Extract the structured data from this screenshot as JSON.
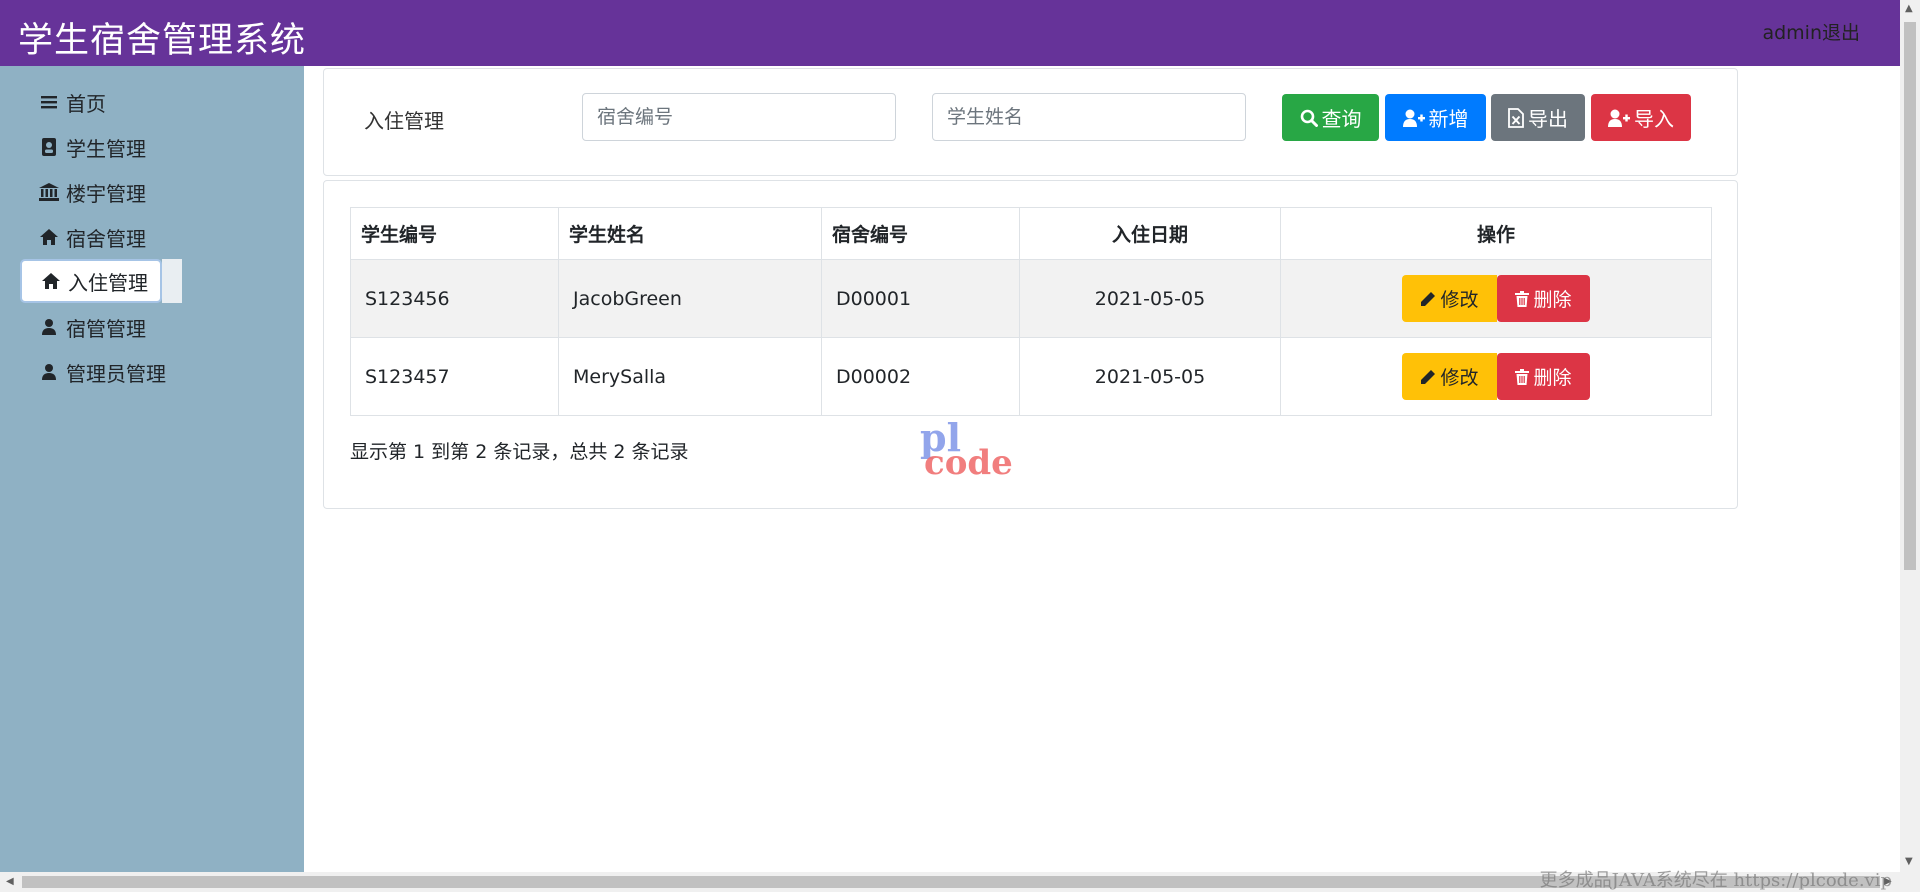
{
  "header": {
    "app_title": "学生宿舍管理系统",
    "logout_label": "admin退出",
    "background": "#663399"
  },
  "sidebar": {
    "background": "#8fb1c4",
    "items": [
      {
        "label": "首页",
        "icon": "bars-icon"
      },
      {
        "label": "学生管理",
        "icon": "id-card-icon"
      },
      {
        "label": "楼宇管理",
        "icon": "building-icon"
      },
      {
        "label": "宿舍管理",
        "icon": "home-icon"
      },
      {
        "label": "入住管理",
        "icon": "home-icon",
        "active": true
      },
      {
        "label": "宿管管理",
        "icon": "user-icon"
      },
      {
        "label": "管理员管理",
        "icon": "user-icon"
      }
    ]
  },
  "search": {
    "page_label": "入住管理",
    "dorm_placeholder": "宿舍编号",
    "name_placeholder": "学生姓名",
    "query_label": "查询",
    "add_label": "新增",
    "export_label": "导出",
    "import_label": "导入"
  },
  "table": {
    "columns": [
      "学生编号",
      "学生姓名",
      "宿舍编号",
      "入住日期",
      "操作"
    ],
    "rows": [
      {
        "student_id": "S123456",
        "student_name": "JacobGreen",
        "dorm_id": "D00001",
        "date": "2021-05-05"
      },
      {
        "student_id": "S123457",
        "student_name": "MerySalla",
        "dorm_id": "D00002",
        "date": "2021-05-05"
      }
    ],
    "edit_label": "修改",
    "delete_label": "删除"
  },
  "pagination": {
    "summary": "显示第 1 到第 2 条记录，总共 2 条记录"
  },
  "watermark": {
    "logo_top": "pl",
    "logo_bottom": "code",
    "footer": "更多成品JAVA系统尽在 https://plcode.vip"
  },
  "colors": {
    "success": "#28a745",
    "primary": "#007bff",
    "secondary": "#6c757d",
    "danger": "#dc3545",
    "warning": "#ffc107"
  }
}
